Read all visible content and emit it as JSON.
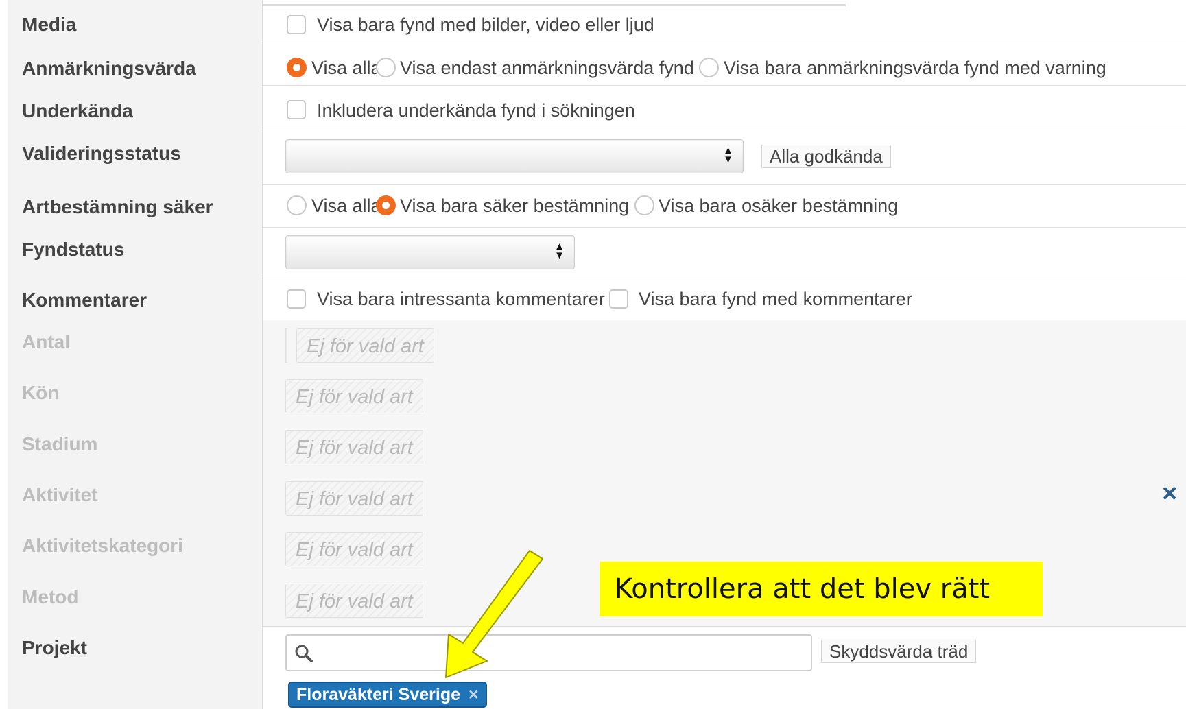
{
  "rows": {
    "media": {
      "label": "Media",
      "checkbox_label": "Visa bara fynd med bilder, video eller ljud"
    },
    "anmarkning": {
      "label": "Anmärkningsvärda",
      "options": [
        "Visa alla",
        "Visa endast anmärkningsvärda fynd",
        "Visa bara anmärkningsvärda fynd med varning"
      ],
      "selected": "Visa alla"
    },
    "underkanda": {
      "label": "Underkända",
      "checkbox_label": "Inkludera underkända fynd i sökningen"
    },
    "validering": {
      "label": "Valideringsstatus",
      "select_value": "",
      "button_label": "Alla godkända"
    },
    "artbestamning": {
      "label": "Artbestämning säker",
      "options": [
        "Visa alla",
        "Visa bara säker bestämning",
        "Visa bara osäker bestämning"
      ],
      "selected": "Visa bara säker bestämning"
    },
    "fyndstatus": {
      "label": "Fyndstatus",
      "select_value": ""
    },
    "kommentarer": {
      "label": "Kommentarer",
      "checkbox1_label": "Visa bara intressanta kommentarer",
      "checkbox2_label": "Visa bara fynd med kommentarer"
    },
    "antal": {
      "label": "Antal",
      "placeholder": "Ej för vald art"
    },
    "kon": {
      "label": "Kön",
      "placeholder": "Ej för vald art"
    },
    "stadium": {
      "label": "Stadium",
      "placeholder": "Ej för vald art"
    },
    "aktivitet": {
      "label": "Aktivitet",
      "placeholder": "Ej för vald art"
    },
    "aktivitetskategori": {
      "label": "Aktivitetskategori",
      "placeholder": "Ej för vald art"
    },
    "metod": {
      "label": "Metod",
      "placeholder": "Ej för vald art"
    },
    "projekt": {
      "label": "Projekt",
      "search_value": "",
      "button_label": "Skyddsvärda träd",
      "tag_label": "Floraväkteri Sverige"
    }
  },
  "close_symbol": "×",
  "tag_remove_symbol": "×",
  "select_arrows": "▲▼",
  "annotation": {
    "text": "Kontrollera att det blev rätt",
    "color": "#ffff00",
    "arrow_color": "#ffff00"
  },
  "colors": {
    "accent_radio": "#f26b1d",
    "tag_background": "#1f74b7",
    "close_icon": "#2d5f8b"
  }
}
